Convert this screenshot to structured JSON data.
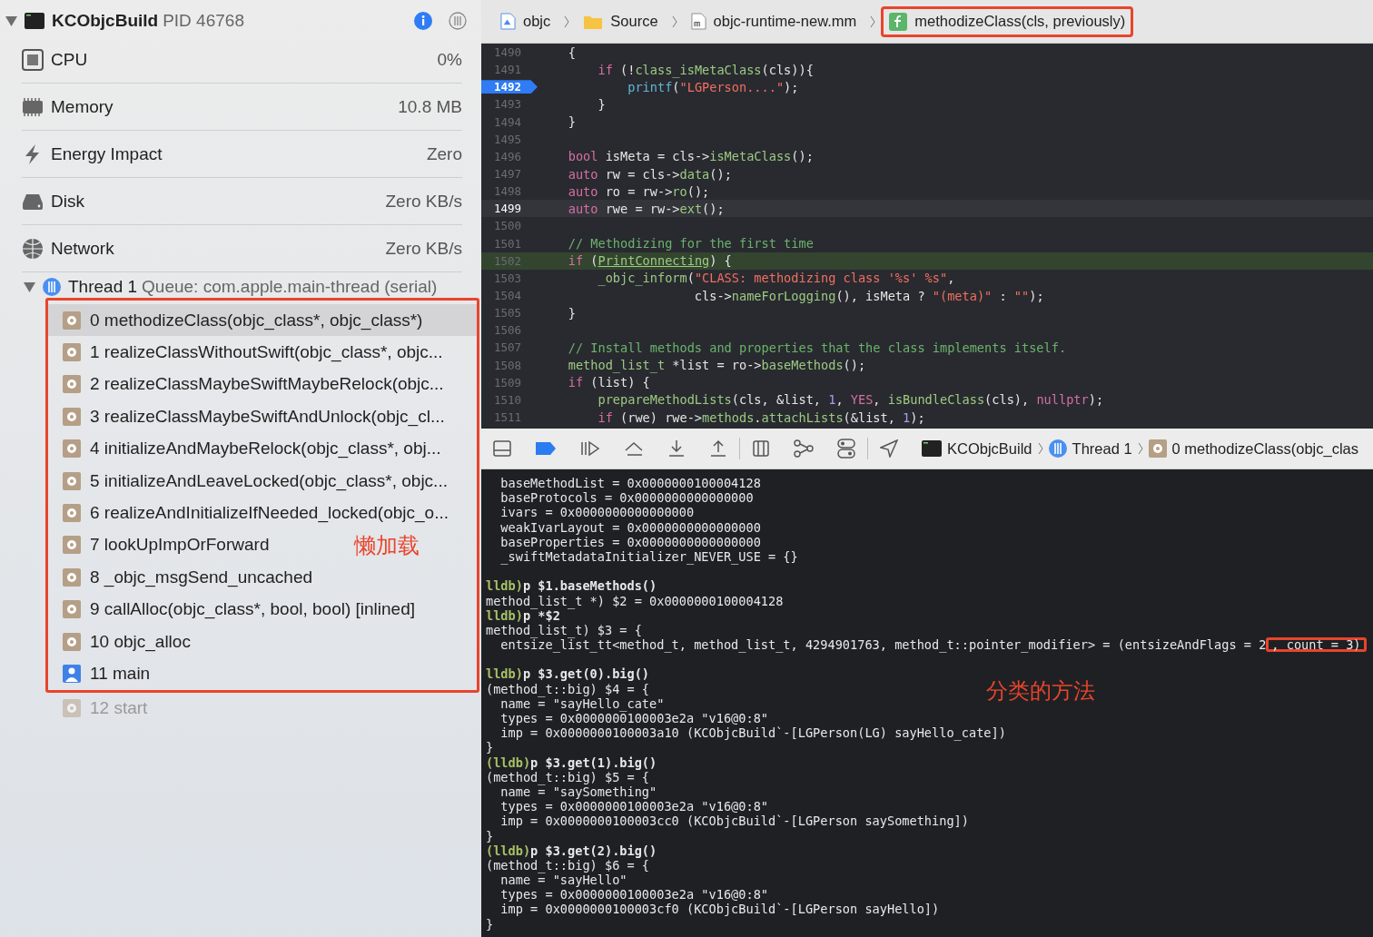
{
  "sidebar": {
    "process": {
      "name": "KCObjcBuild",
      "pid": "PID 46768",
      "expanded": true
    },
    "gauges": [
      {
        "kind": "cpu",
        "label": "CPU",
        "value": "0%"
      },
      {
        "kind": "memory",
        "label": "Memory",
        "value": "10.8 MB"
      },
      {
        "kind": "energy",
        "label": "Energy Impact",
        "value": "Zero"
      },
      {
        "kind": "disk",
        "label": "Disk",
        "value": "Zero KB/s"
      },
      {
        "kind": "network",
        "label": "Network",
        "value": "Zero KB/s"
      }
    ],
    "thread": {
      "name": "Thread 1",
      "queue": "Queue: com.apple.main-thread (serial)",
      "expanded": true
    },
    "frames": [
      {
        "label": "0 methodizeClass(objc_class*, objc_class*)",
        "kind": "system",
        "selected": true,
        "disabled": false,
        "annotated": true
      },
      {
        "label": "1 realizeClassWithoutSwift(objc_class*, objc...",
        "kind": "system",
        "selected": false,
        "disabled": false,
        "annotated": true
      },
      {
        "label": "2 realizeClassMaybeSwiftMaybeRelock(objc...",
        "kind": "system",
        "selected": false,
        "disabled": false,
        "annotated": true
      },
      {
        "label": "3 realizeClassMaybeSwiftAndUnlock(objc_cl...",
        "kind": "system",
        "selected": false,
        "disabled": false,
        "annotated": true
      },
      {
        "label": "4 initializeAndMaybeRelock(objc_class*, obj...",
        "kind": "system",
        "selected": false,
        "disabled": false,
        "annotated": true
      },
      {
        "label": "5 initializeAndLeaveLocked(objc_class*, objc...",
        "kind": "system",
        "selected": false,
        "disabled": false,
        "annotated": true
      },
      {
        "label": "6 realizeAndInitializeIfNeeded_locked(objc_o...",
        "kind": "system",
        "selected": false,
        "disabled": false,
        "annotated": true
      },
      {
        "label": "7 lookUpImpOrForward",
        "kind": "system",
        "selected": false,
        "disabled": false,
        "annotated": true,
        "note": "懒加载"
      },
      {
        "label": "8 _objc_msgSend_uncached",
        "kind": "system",
        "selected": false,
        "disabled": false,
        "annotated": true
      },
      {
        "label": "9 callAlloc(objc_class*, bool, bool) [inlined]",
        "kind": "system",
        "selected": false,
        "disabled": false,
        "annotated": true
      },
      {
        "label": "10 objc_alloc",
        "kind": "system",
        "selected": false,
        "disabled": false,
        "annotated": true
      },
      {
        "label": "11 main",
        "kind": "user",
        "selected": false,
        "disabled": false,
        "annotated": true
      },
      {
        "label": "12 start",
        "kind": "system",
        "selected": false,
        "disabled": true,
        "annotated": false
      }
    ]
  },
  "editor": {
    "breadcrumb": [
      {
        "kind": "project",
        "label": "objc",
        "highlighted": false
      },
      {
        "kind": "folder",
        "label": "Source",
        "highlighted": false
      },
      {
        "kind": "objc-file",
        "label": "objc-runtime-new.mm",
        "highlighted": false
      },
      {
        "kind": "function",
        "label": "methodizeClass(cls, previously)",
        "highlighted": true
      }
    ],
    "lines": [
      {
        "number": "1490",
        "current": false,
        "selected": false,
        "highlighted": false,
        "tokens": [
          {
            "kind": "plain",
            "text": "    {"
          }
        ]
      },
      {
        "number": "1491",
        "current": false,
        "selected": false,
        "highlighted": false,
        "tokens": [
          {
            "kind": "keyword",
            "text": "        if"
          },
          {
            "kind": "plain",
            "text": " (!"
          },
          {
            "kind": "function",
            "text": "class_isMetaClass"
          },
          {
            "kind": "plain",
            "text": "(cls)){"
          }
        ]
      },
      {
        "number": "1492",
        "current": true,
        "selected": false,
        "highlighted": false,
        "tokens": [
          {
            "kind": "system",
            "text": "            printf"
          },
          {
            "kind": "plain",
            "text": "("
          },
          {
            "kind": "string",
            "text": "\"LGPerson....\""
          },
          {
            "kind": "plain",
            "text": ");"
          }
        ]
      },
      {
        "number": "1493",
        "current": false,
        "selected": false,
        "highlighted": false,
        "tokens": [
          {
            "kind": "plain",
            "text": "        }"
          }
        ]
      },
      {
        "number": "1494",
        "current": false,
        "selected": false,
        "highlighted": false,
        "tokens": [
          {
            "kind": "plain",
            "text": "    }"
          }
        ]
      },
      {
        "number": "1495",
        "current": false,
        "selected": false,
        "highlighted": false
      },
      {
        "number": "1496",
        "current": false,
        "selected": false,
        "highlighted": false,
        "tokens": [
          {
            "kind": "keyword",
            "text": "    bool"
          },
          {
            "kind": "plain",
            "text": " isMeta = cls->"
          },
          {
            "kind": "function",
            "text": "isMetaClass"
          },
          {
            "kind": "plain",
            "text": "();"
          }
        ]
      },
      {
        "number": "1497",
        "current": false,
        "selected": false,
        "highlighted": false,
        "tokens": [
          {
            "kind": "keyword",
            "text": "    auto"
          },
          {
            "kind": "plain",
            "text": " rw = cls->"
          },
          {
            "kind": "function",
            "text": "data"
          },
          {
            "kind": "plain",
            "text": "();"
          }
        ]
      },
      {
        "number": "1498",
        "current": false,
        "selected": false,
        "highlighted": false,
        "tokens": [
          {
            "kind": "keyword",
            "text": "    auto"
          },
          {
            "kind": "plain",
            "text": " ro = rw->"
          },
          {
            "kind": "function",
            "text": "ro"
          },
          {
            "kind": "plain",
            "text": "();"
          }
        ]
      },
      {
        "number": "1499",
        "current": false,
        "selected": true,
        "highlighted": false,
        "tokens": [
          {
            "kind": "keyword",
            "text": "    auto"
          },
          {
            "kind": "plain",
            "text": " rwe = rw->"
          },
          {
            "kind": "function",
            "text": "ext"
          },
          {
            "kind": "plain",
            "text": "();"
          }
        ]
      },
      {
        "number": "1500",
        "current": false,
        "selected": false,
        "highlighted": false
      },
      {
        "number": "1501",
        "current": false,
        "selected": false,
        "highlighted": false,
        "tokens": [
          {
            "kind": "comment",
            "text": "    // Methodizing for the first time"
          }
        ]
      },
      {
        "number": "1502",
        "current": false,
        "selected": false,
        "highlighted": true,
        "tokens": [
          {
            "kind": "keyword",
            "text": "    if"
          },
          {
            "kind": "plain",
            "text": " ("
          },
          {
            "kind": "link",
            "text": "PrintConnecting"
          },
          {
            "kind": "plain",
            "text": ") {"
          }
        ]
      },
      {
        "number": "1503",
        "current": false,
        "selected": false,
        "highlighted": false,
        "tokens": [
          {
            "kind": "function",
            "text": "        _objc_inform"
          },
          {
            "kind": "plain",
            "text": "("
          },
          {
            "kind": "string",
            "text": "\"CLASS: methodizing class '%s' %s\""
          },
          {
            "kind": "plain",
            "text": ","
          }
        ]
      },
      {
        "number": "1504",
        "current": false,
        "selected": false,
        "highlighted": false,
        "tokens": [
          {
            "kind": "plain",
            "text": "                     cls->"
          },
          {
            "kind": "function",
            "text": "nameForLogging"
          },
          {
            "kind": "plain",
            "text": "(), isMeta ? "
          },
          {
            "kind": "string",
            "text": "\"(meta)\""
          },
          {
            "kind": "plain",
            "text": " : "
          },
          {
            "kind": "string",
            "text": "\"\""
          },
          {
            "kind": "plain",
            "text": ");"
          }
        ]
      },
      {
        "number": "1505",
        "current": false,
        "selected": false,
        "highlighted": false,
        "tokens": [
          {
            "kind": "plain",
            "text": "    }"
          }
        ]
      },
      {
        "number": "1506",
        "current": false,
        "selected": false,
        "highlighted": false
      },
      {
        "number": "1507",
        "current": false,
        "selected": false,
        "highlighted": false,
        "tokens": [
          {
            "kind": "comment",
            "text": "    // Install methods and properties that the class implements itself."
          }
        ]
      },
      {
        "number": "1508",
        "current": false,
        "selected": false,
        "highlighted": false,
        "tokens": [
          {
            "kind": "function",
            "text": "    method_list_t"
          },
          {
            "kind": "plain",
            "text": " *list = ro->"
          },
          {
            "kind": "function",
            "text": "baseMethods"
          },
          {
            "kind": "plain",
            "text": "();"
          }
        ]
      },
      {
        "number": "1509",
        "current": false,
        "selected": false,
        "highlighted": false,
        "tokens": [
          {
            "kind": "keyword",
            "text": "    if"
          },
          {
            "kind": "plain",
            "text": " (list) {"
          }
        ]
      },
      {
        "number": "1510",
        "current": false,
        "selected": false,
        "highlighted": false,
        "tokens": [
          {
            "kind": "function",
            "text": "        prepareMethodLists"
          },
          {
            "kind": "plain",
            "text": "(cls, &list, "
          },
          {
            "kind": "number",
            "text": "1"
          },
          {
            "kind": "plain",
            "text": ", "
          },
          {
            "kind": "keyword",
            "text": "YES"
          },
          {
            "kind": "plain",
            "text": ", "
          },
          {
            "kind": "function",
            "text": "isBundleClass"
          },
          {
            "kind": "plain",
            "text": "(cls), "
          },
          {
            "kind": "keyword",
            "text": "nullptr"
          },
          {
            "kind": "plain",
            "text": ");"
          }
        ]
      },
      {
        "number": "1511",
        "current": false,
        "selected": false,
        "highlighted": false,
        "tokens": [
          {
            "kind": "keyword",
            "text": "        if"
          },
          {
            "kind": "plain",
            "text": " (rwe) rwe->"
          },
          {
            "kind": "function",
            "text": "methods"
          },
          {
            "kind": "plain",
            "text": "."
          },
          {
            "kind": "function",
            "text": "attachLists"
          },
          {
            "kind": "plain",
            "text": "(&list, "
          },
          {
            "kind": "number",
            "text": "1"
          },
          {
            "kind": "plain",
            "text": ");"
          }
        ]
      }
    ]
  },
  "debug_bar": {
    "breadcrumb": [
      {
        "kind": "app",
        "label": "KCObjcBuild"
      },
      {
        "kind": "thread",
        "label": "Thread 1"
      },
      {
        "kind": "frame",
        "label": "0 methodizeClass(objc_clas"
      }
    ]
  },
  "console": {
    "blocks": [
      {
        "lines": [
          {
            "text": "  baseMethodList = 0x0000000100004128"
          },
          {
            "text": "  baseProtocols = 0x0000000000000000"
          },
          {
            "text": "  ivars = 0x0000000000000000"
          },
          {
            "text": "  weakIvarLayout = 0x0000000000000000"
          },
          {
            "text": "  baseProperties = 0x0000000000000000"
          },
          {
            "text": "  _swiftMetadataInitializer_NEVER_USE = {}"
          }
        ]
      },
      {
        "lines": [
          {
            "prompt": "lldb)",
            "text": "p $1.baseMethods()"
          },
          {
            "text": "method_list_t *) $2 = 0x0000000100004128"
          },
          {
            "prompt": "lldb)",
            "text": "p *$2"
          },
          {
            "text": "method_list_t) $3 = {"
          },
          {
            "text": "  entsize_list_tt<method_t, method_list_t, 4294901763, method_t::pointer_modifier> = (entsizeAndFlags = 2",
            "boxed": ", count = 3)"
          }
        ]
      },
      {
        "lines": [
          {
            "prompt": "lldb)",
            "text": "p $3.get(0).big()"
          },
          {
            "text": "(method_t::big) $4 = {"
          },
          {
            "text": "  name = \"sayHello_cate\"",
            "note": "分类的方法"
          },
          {
            "text": "  types = 0x0000000100003e2a \"v16@0:8\""
          },
          {
            "text": "  imp = 0x0000000100003a10 (KCObjcBuild`-[LGPerson(LG) sayHello_cate])"
          },
          {
            "text": "}"
          },
          {
            "prompt": "(lldb)",
            "text": "p $3.get(1).big()"
          },
          {
            "text": "(method_t::big) $5 = {"
          },
          {
            "text": "  name = \"saySomething\""
          },
          {
            "text": "  types = 0x0000000100003e2a \"v16@0:8\""
          },
          {
            "text": "  imp = 0x0000000100003cc0 (KCObjcBuild`-[LGPerson saySomething])"
          },
          {
            "text": "}"
          },
          {
            "prompt": "(lldb)",
            "text": "p $3.get(2).big()"
          },
          {
            "text": "(method_t::big) $6 = {"
          },
          {
            "text": "  name = \"sayHello\""
          },
          {
            "text": "  types = 0x0000000100003e2a \"v16@0:8\""
          },
          {
            "text": "  imp = 0x0000000100003cf0 (KCObjcBuild`-[LGPerson sayHello])"
          },
          {
            "text": "}"
          }
        ]
      }
    ]
  }
}
